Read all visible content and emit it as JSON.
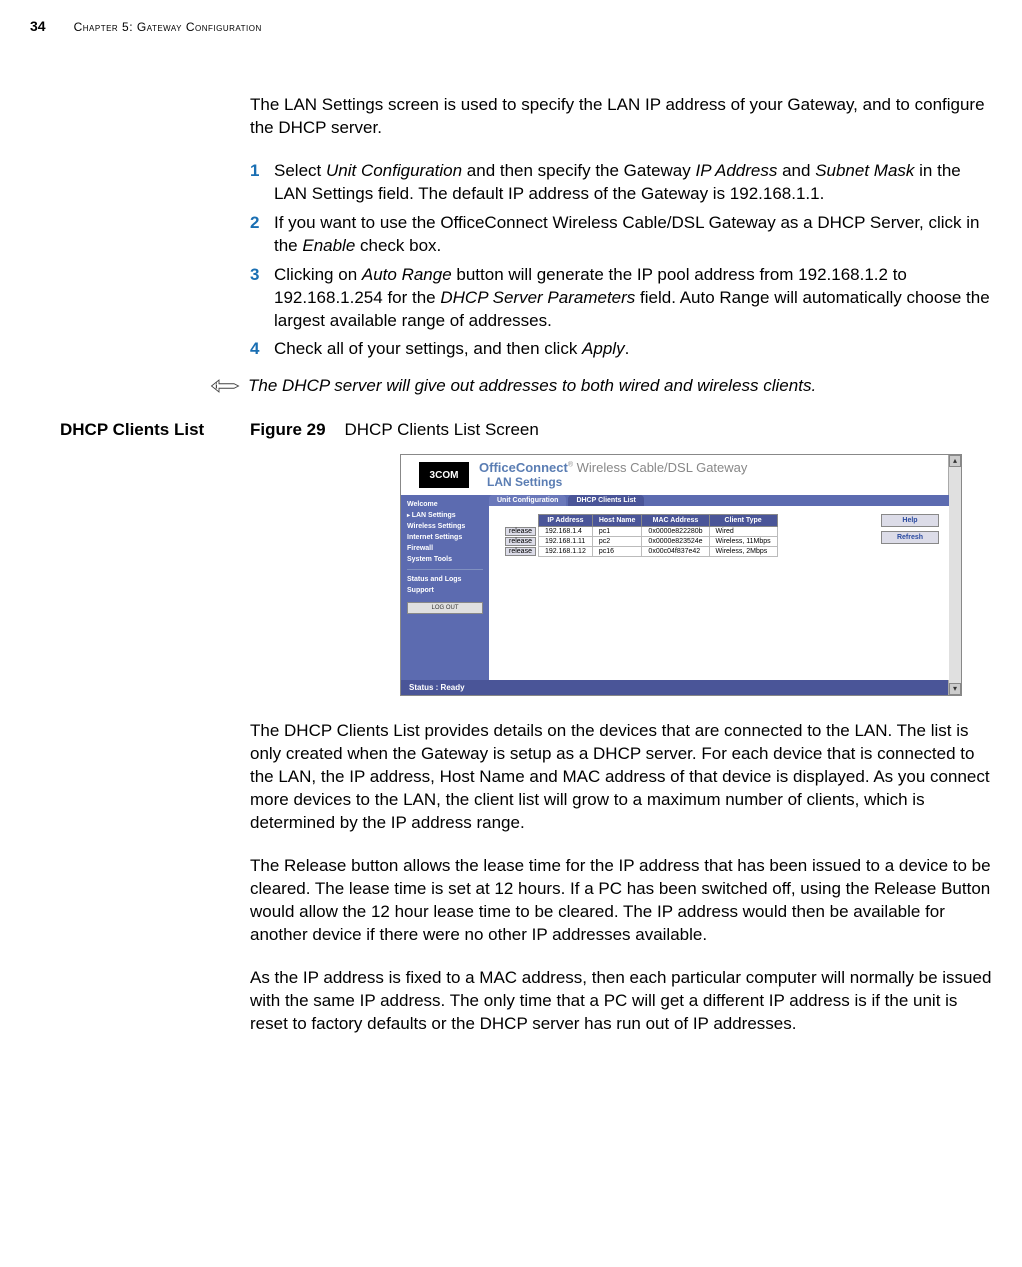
{
  "header": {
    "page_number": "34",
    "chapter": "Chapter 5: Gateway Configuration"
  },
  "intro": {
    "text": "The LAN Settings screen is used to specify the LAN IP address of your Gateway, and to configure the DHCP server."
  },
  "steps": [
    {
      "num": "1",
      "prefix": "Select ",
      "i1": "Unit Configuration",
      "mid1": " and then specify the Gateway ",
      "i2": "IP Address",
      "mid2": " and ",
      "i3": "Subnet Mask",
      "suffix": " in the LAN Settings field. The default IP address of the Gateway is 192.168.1.1."
    },
    {
      "num": "2",
      "prefix": "If you want to use the OfficeConnect Wireless Cable/DSL Gateway as a DHCP Server, click in the ",
      "i1": "Enable",
      "suffix": " check box."
    },
    {
      "num": "3",
      "prefix": "Clicking on ",
      "i1": "Auto Range",
      "mid1": " button will generate the IP pool address from 192.168.1.2 to 192.168.1.254 for the ",
      "i2": "DHCP Server Parameters",
      "suffix": " field. Auto Range will automatically choose the largest available range of addresses."
    },
    {
      "num": "4",
      "prefix": "Check all of your settings, and then click ",
      "i1": "Apply",
      "suffix": "."
    }
  ],
  "note": "The DHCP server will give out addresses to both wired and wireless clients.",
  "section": {
    "heading": "DHCP Clients List",
    "figure_label": "Figure 29",
    "figure_caption": "DHCP Clients List Screen"
  },
  "screenshot": {
    "logo": "3COM",
    "brand_bold": "OfficeConnect",
    "brand_rest": "Wireless Cable/DSL Gateway",
    "pane_title": "LAN Settings",
    "sidebar": [
      "Welcome",
      "LAN Settings",
      "Wireless Settings",
      "Internet Settings",
      "Firewall",
      "System Tools"
    ],
    "sidebar2": [
      "Status and Logs",
      "Support"
    ],
    "logout": "LOG OUT",
    "tabs": {
      "t1": "Unit Configuration",
      "t2": "DHCP Clients List"
    },
    "columns": {
      "c0": "",
      "c1": "IP Address",
      "c2": "Host Name",
      "c3": "MAC Address",
      "c4": "Client Type"
    },
    "rows": [
      {
        "btn": "release",
        "ip": "192.168.1.4",
        "host": "pc1",
        "mac": "0x0000e822280b",
        "type": "Wired"
      },
      {
        "btn": "release",
        "ip": "192.168.1.11",
        "host": "pc2",
        "mac": "0x0000e823524e",
        "type": "Wireless, 11Mbps"
      },
      {
        "btn": "release",
        "ip": "192.168.1.12",
        "host": "pc16",
        "mac": "0x00c04f837e42",
        "type": "Wireless, 2Mbps"
      }
    ],
    "buttons": {
      "help": "Help",
      "refresh": "Refresh"
    },
    "status": "Status : Ready"
  },
  "body1": "The DHCP Clients List provides details on the devices that are connected to the LAN. The list is only created when the Gateway is setup as a DHCP server. For each device that is connected to the LAN, the IP address, Host Name and MAC address of that device is displayed. As you connect more devices to the LAN, the client list will grow to a maximum number of clients, which is determined by the IP address range.",
  "body2": "The Release button allows the lease time for the IP address that has been issued to a device to be cleared. The lease time is set at 12 hours. If a PC has been switched off, using the Release Button would allow the 12 hour lease time to be cleared. The IP address would then be available for another device if there were no other IP addresses available.",
  "body3": "As the IP address is fixed to a MAC address, then each particular computer will normally be issued with the same IP address. The only time that a PC will get a different IP address is if the unit is reset to factory defaults or the DHCP server has run out of IP addresses."
}
